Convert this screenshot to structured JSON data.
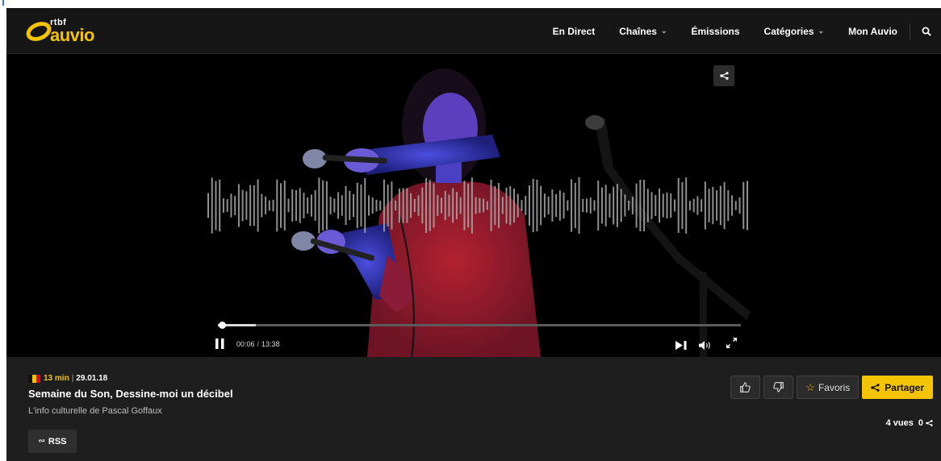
{
  "brand": {
    "rtbf": "rtbf",
    "auvio": "auvio",
    "accent": "#f5c400"
  },
  "nav": {
    "items": [
      {
        "label": "En Direct",
        "dropdown": false
      },
      {
        "label": "Chaînes",
        "dropdown": true
      },
      {
        "label": "Émissions",
        "dropdown": false
      },
      {
        "label": "Catégories",
        "dropdown": true
      },
      {
        "label": "Mon Auvio",
        "dropdown": false
      }
    ],
    "search_icon": "search-icon"
  },
  "player": {
    "current_time": "00:06",
    "separator": "/",
    "duration": "13:38",
    "progress": 0.0073,
    "buffered": 0.073,
    "state": "playing",
    "icons": [
      "share-icon",
      "pause-icon",
      "skip-next-icon",
      "volume-icon",
      "fullscreen-icon"
    ]
  },
  "episode": {
    "duration": "13 min",
    "pipe": "|",
    "date": "29.01.18",
    "title": "Semaine du Son, Dessine-moi un décibel",
    "subtitle": "L'info culturelle de Pascal Goffaux",
    "flag_colors": [
      "#111111",
      "#f5c400",
      "#e30613"
    ]
  },
  "actions": {
    "favorites": "Favoris",
    "share": "Partager",
    "rss": "RSS",
    "icons": [
      "thumbs-up-icon",
      "thumbs-down-icon",
      "star-icon",
      "share-icon",
      "rss-icon"
    ]
  },
  "stats": {
    "views": "4 vues",
    "shares": "0"
  }
}
